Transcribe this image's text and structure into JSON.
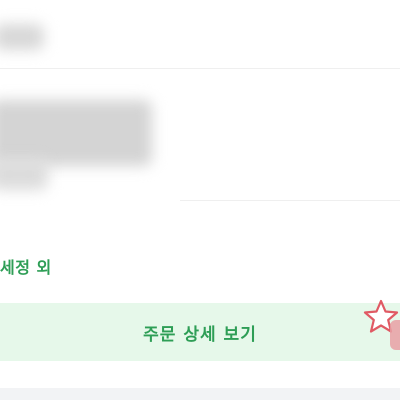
{
  "order": {
    "status_text": "세정 외",
    "detail_button_label": "주문 상세 보기"
  },
  "colors": {
    "accent": "#2e9e56",
    "button_background": "#e6f8ea",
    "star": "#e05a64"
  },
  "icons": {
    "star": "star-icon"
  }
}
